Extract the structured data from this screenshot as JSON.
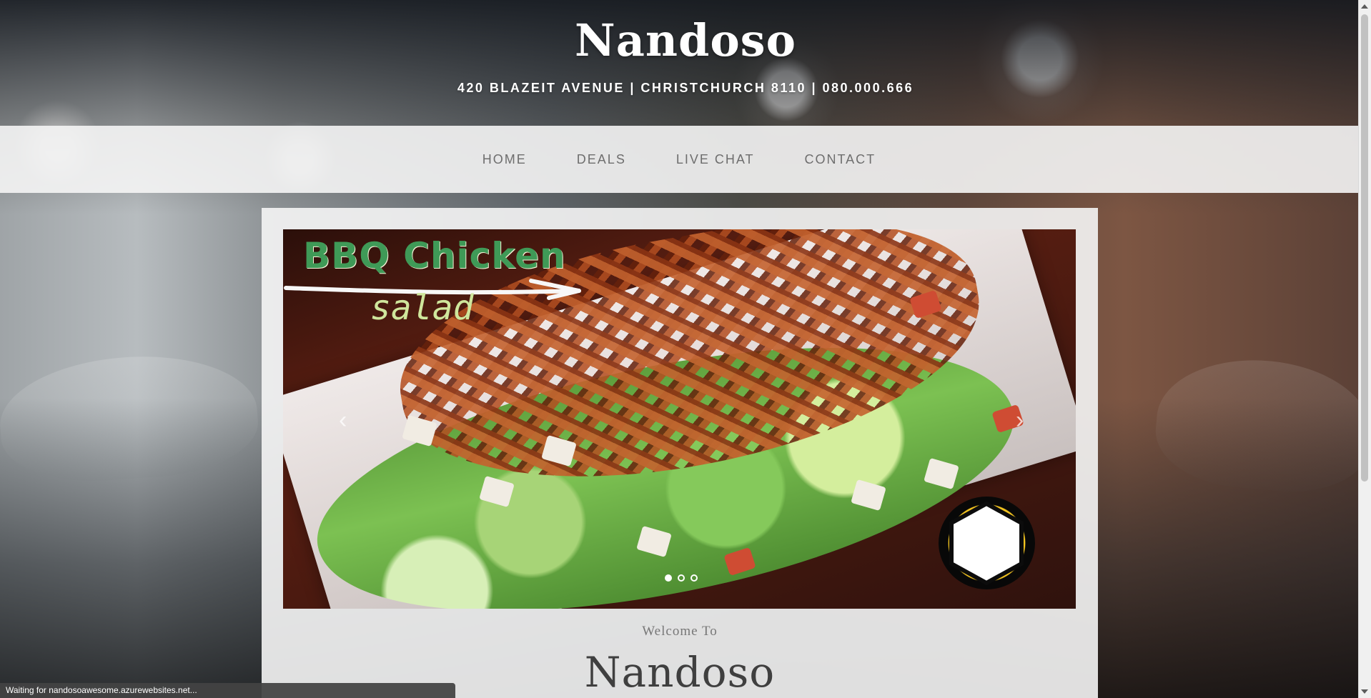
{
  "header": {
    "site_title": "Nandoso",
    "address": "420 BLAZEIT AVENUE | CHRISTCHURCH 8110 | 080.000.666"
  },
  "nav": {
    "items": [
      {
        "label": "HOME"
      },
      {
        "label": "DEALS"
      },
      {
        "label": "LIVE CHAT"
      },
      {
        "label": "CONTACT"
      }
    ]
  },
  "carousel": {
    "headline": "BBQ Chicken",
    "subheadline": "salad",
    "prev_icon": "‹",
    "next_icon": "›",
    "active_slide": 1,
    "slide_count": 3
  },
  "welcome": {
    "label": "Welcome To",
    "title": "Nandoso"
  },
  "status": {
    "text": "Waiting for nandosoawesome.azurewebsites.net..."
  },
  "icons": {
    "prev_arrow": "chevron-left-icon",
    "next_arrow": "chevron-right-icon"
  },
  "colors": {
    "nav_background": "#f5f5f5",
    "card_background": "#f5f5f5",
    "status_background": "#434343"
  }
}
